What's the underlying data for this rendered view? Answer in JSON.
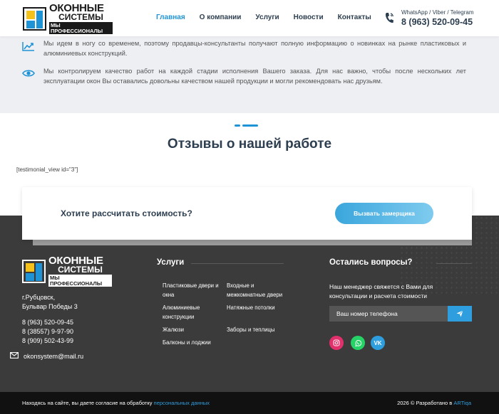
{
  "header": {
    "logo": {
      "line1": "ОКОННЫЕ",
      "line2": "СИСТЕМЫ",
      "line3": "МЫ ПРОФЕССИОНАЛЫ"
    },
    "nav": [
      {
        "label": "Главная",
        "active": true
      },
      {
        "label": "О компании",
        "active": false
      },
      {
        "label": "Услуги",
        "active": false
      },
      {
        "label": "Новости",
        "active": false
      },
      {
        "label": "Контакты",
        "active": false
      }
    ],
    "contact_label": "WhatsApp / Viber / Telegram",
    "phone": "8 (963) 520-09-45"
  },
  "features": [
    {
      "icon": "trend-chart-icon",
      "text": "Мы идем в ногу со временем, поэтому продавцы-консультанты получают полную информацию о новинках на рынке пластиковых и алюминиевых конструкций."
    },
    {
      "icon": "eye-icon",
      "text": "Мы контролируем качество работ на каждой стадии исполнения Вашего заказа. Для нас важно, чтобы после нескольких лет эксплуатации окон Вы оставались довольны качеством нашей продукции и могли рекомендовать нас друзьям."
    }
  ],
  "reviews": {
    "title": "Отзывы о нашей работе",
    "shortcode": "[testimonial_view id=\"3\"]"
  },
  "cta": {
    "text": "Хотите рассчитать стоимость?",
    "button": "Вызвать замерщика"
  },
  "footer": {
    "logo": {
      "line1": "ОКОННЫЕ",
      "line2": "СИСТЕМЫ",
      "line3": "МЫ ПРОФЕССИОНАЛЫ"
    },
    "address_line1": "г.Рубцовск,",
    "address_line2": "Бульвар Победы 3",
    "phones": [
      "8 (963) 520-09-45",
      "8 (38557) 9-97-90",
      "8 (909) 502-43-99"
    ],
    "email": "okonsystem@mail.ru",
    "services_title": "Услуги",
    "services_col1": [
      "Пластиковые двери и окна",
      "Алюминиевые конструкции",
      "Жалюзи",
      "Балконы и лоджии"
    ],
    "services_col2": [
      "Входные и межкомнатные двери",
      "Натяжные потолки",
      "Заборы и теплицы"
    ],
    "questions_title": "Остались вопросы?",
    "questions_text": "Наш менеджер свяжется с Вами для консультации и расчета стоимости",
    "phone_placeholder": "Ваш номер телефона",
    "social": [
      {
        "icon": "instagram-icon",
        "color": "#e1306c"
      },
      {
        "icon": "whatsapp-icon",
        "color": "#25d366"
      },
      {
        "icon": "vk-icon",
        "color": "#2f9ede"
      }
    ]
  },
  "bottom": {
    "consent_text": "Находясь на сайте, вы даете согласие на обработку",
    "consent_link": "персональных данных",
    "copyright": "2026 © Разработано в",
    "developer": "ARTiqa"
  },
  "colors": {
    "accent": "#1e94d6",
    "dark": "#2c3e50",
    "footer": "#3b3b3b"
  }
}
